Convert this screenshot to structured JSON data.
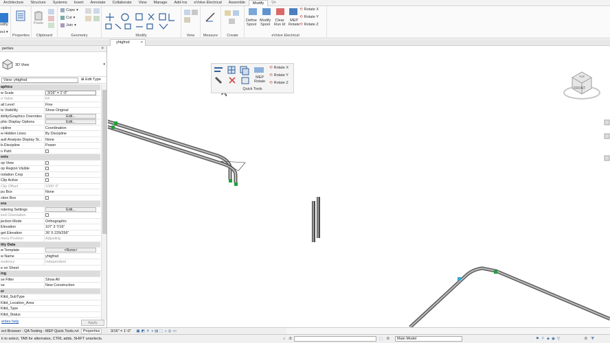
{
  "ribbon_tabs": [
    "Architecture",
    "Structure",
    "Systems",
    "Insert",
    "Annotate",
    "Collaborate",
    "View",
    "Manage",
    "Add-Ins",
    "eVolve Electrical",
    "Assemble",
    "Modify",
    "▽•"
  ],
  "active_tab": "Modify",
  "ribbon": {
    "modify_label": "odify",
    "select_label": "ect ▾",
    "properties_group": "Properties",
    "clipboard": {
      "paste": "Paste",
      "group": "Clipboard"
    },
    "geometry": {
      "cope": "Cope",
      "cut": "Cut",
      "join": "Join",
      "group": "Geometry"
    },
    "modify_group": "Modify",
    "view_group": "View",
    "measure_group": "Measure",
    "create_group": "Create",
    "evolve": {
      "define_spool": "Define\nSpool",
      "modify_spool": "Modify\nSpool",
      "clear_run_id": "Clear\nRun Id",
      "mep_rotate": "MEP\nRotate",
      "rotate_x": "Rotate X",
      "rotate_y": "Rotate Y",
      "rotate_z": "Rotate Z",
      "group": "eVolve Electrical"
    }
  },
  "view_tab": "yhtgfrsd",
  "properties": {
    "title": "perties",
    "type_name": "3D View",
    "instance_selector": "View: yhtgfrsd",
    "edit_type": "Edit Type",
    "rows": [
      {
        "k": "aphics",
        "v": "",
        "kind": "head"
      },
      {
        "k": "w Scale",
        "v": "3/16\" = 1'-0\"",
        "kind": "field"
      },
      {
        "k": "e Value",
        "v": "64",
        "kind": "dim"
      },
      {
        "k": "ail Level",
        "v": "Fine",
        "kind": "text"
      },
      {
        "k": "ts Visibility",
        "v": "Show Original",
        "kind": "text"
      },
      {
        "k": "ibility/Graphics Overrides",
        "v": "Edit...",
        "kind": "button"
      },
      {
        "k": "phic Display Options",
        "v": "Edit...",
        "kind": "button"
      },
      {
        "k": "cipline",
        "v": "Coordination",
        "kind": "text"
      },
      {
        "k": "w Hidden Lines",
        "v": "By Discipline",
        "kind": "text"
      },
      {
        "k": "ault Analysis Display St...",
        "v": "None",
        "kind": "text"
      },
      {
        "k": "b-Discipline",
        "v": "Power",
        "kind": "text"
      },
      {
        "k": "n Path",
        "v": "",
        "kind": "check"
      },
      {
        "k": "ents",
        "v": "",
        "kind": "head"
      },
      {
        "k": "op View",
        "v": "",
        "kind": "check"
      },
      {
        "k": "op Region Visible",
        "v": "",
        "kind": "check"
      },
      {
        "k": "notation Crop",
        "v": "",
        "kind": "check"
      },
      {
        "k": "Clip Active",
        "v": "",
        "kind": "check"
      },
      {
        "k": "Clip Offset",
        "v": "1000' 0\"",
        "kind": "dim"
      },
      {
        "k": "pu Box",
        "v": "None",
        "kind": "text"
      },
      {
        "k": "ction Box",
        "v": "",
        "kind": "check"
      },
      {
        "k": "era",
        "v": "",
        "kind": "head"
      },
      {
        "k": "ndering Settings",
        "v": "Edit...",
        "kind": "button"
      },
      {
        "k": "ked Orientation",
        "v": "",
        "kind": "dimcheck"
      },
      {
        "k": "jection Mode",
        "v": "Orthographic",
        "kind": "text"
      },
      {
        "k": "Elevation",
        "v": "107' 3 7/16\"",
        "kind": "text"
      },
      {
        "k": "get Elevation",
        "v": "26' 5 229/256\"",
        "kind": "text"
      },
      {
        "k": "mera Position",
        "v": "Adjusting",
        "kind": "dim"
      },
      {
        "k": "tity Data",
        "v": "",
        "kind": "head"
      },
      {
        "k": "w Template",
        "v": "<None>",
        "kind": "button"
      },
      {
        "k": "w Name",
        "v": "yhtgfrsd",
        "kind": "text"
      },
      {
        "k": "endency",
        "v": "Independent",
        "kind": "dim"
      },
      {
        "k": "e on Sheet",
        "v": "",
        "kind": "text"
      },
      {
        "k": "ing",
        "v": "",
        "kind": "head"
      },
      {
        "k": "se Filter",
        "v": "Show All",
        "kind": "text"
      },
      {
        "k": "se",
        "v": "New Construction",
        "kind": "text"
      },
      {
        "k": "er",
        "v": "",
        "kind": "head"
      },
      {
        "k": "Kitid_SubType",
        "v": "",
        "kind": "text"
      },
      {
        "k": "Kitid_Location_Area",
        "v": "",
        "kind": "text"
      },
      {
        "k": "Kitid_Type",
        "v": "",
        "kind": "text"
      },
      {
        "k": "Kitid_Status",
        "v": "",
        "kind": "text"
      }
    ],
    "help": "erties help",
    "apply": "Apply"
  },
  "quick_tools": {
    "label": "Quick Tools",
    "mep_rotate": "MEP\nRotate",
    "rotate_x": "Rotate X",
    "rotate_y": "Rotate Y",
    "rotate_z": "Rotate Z"
  },
  "viewcube": {
    "face": "FRONT",
    "top": "TOP"
  },
  "view_control": {
    "scale": "3/16\" = 1'-0\""
  },
  "browser_tabs": [
    "ect Browser - QA Testing - MEP Quick Tools.rvt",
    "Properties"
  ],
  "status": {
    "message": "k to select, TAB for alternates, CTRL adds, SHIFT unselects.",
    "zero": ":0",
    "model": "Main Model"
  },
  "colors": {
    "connector": "#1fa23a",
    "pipe": "#6f6f6f",
    "accent": "#1f6fbf"
  }
}
